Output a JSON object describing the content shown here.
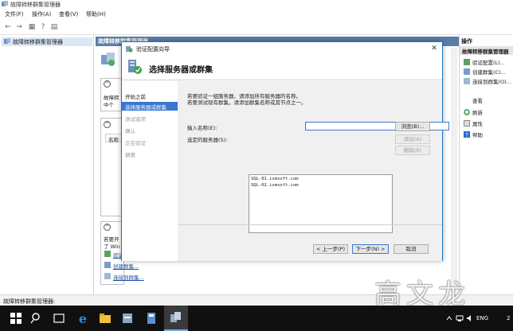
{
  "app": {
    "title": "故障转移群集管理器"
  },
  "menu": [
    "文件(F)",
    "操作(A)",
    "查看(V)",
    "帮助(H)"
  ],
  "tree": {
    "root": "故障转移群集管理器"
  },
  "center": {
    "header": "故障转移群集管理器",
    "section1_text": [
      "故障转",
      "中个"
    ],
    "col_header": "名称",
    "bottom_text": [
      "若要开",
      "了 Win"
    ],
    "links": [
      "验证",
      "创建群集...",
      "连接到群集..."
    ]
  },
  "actions": {
    "title": "操作",
    "group": "故障转移群集管理器",
    "items": [
      "验证配置(L)...",
      "创建群集(C)...",
      "连接到群集(O)...",
      "查看",
      "刷新",
      "属性",
      "帮助"
    ]
  },
  "status": "故障转移群集管理器:",
  "taskbar": {
    "lang": "ENG",
    "num": "2"
  },
  "dialog": {
    "title": "验证配置向导",
    "header": "选择服务器或群集",
    "steps": [
      {
        "label": "开始之前",
        "state": "normal"
      },
      {
        "label": "选择服务器或群集",
        "state": "active"
      },
      {
        "label": "测试选项",
        "state": "disabled"
      },
      {
        "label": "确认",
        "state": "disabled"
      },
      {
        "label": "正在验证",
        "state": "disabled"
      },
      {
        "label": "摘要",
        "state": "disabled"
      }
    ],
    "intro1": "若要验证一组服务器，请添加所有服务器的名称。",
    "intro2": "若要测试现有群集，请添加群集名称或其节点之一。",
    "name_label": "输入名称(E):",
    "name_value": "",
    "browse": "浏览(B)...",
    "selected_label": "选定的服务器(S):",
    "servers": [
      "SQL-01.ixmsoft.com",
      "SQL-02.ixmsoft.com"
    ],
    "add": "添加(A)",
    "remove": "删除(R)",
    "prev": "< 上一步(P)",
    "next": "下一步(N) >",
    "cancel": "取消"
  },
  "watermark": "高文龙",
  "colors": {
    "accent": "#3a77d0",
    "header_blue": "#5a7ea8",
    "taskbar": "#101010"
  }
}
